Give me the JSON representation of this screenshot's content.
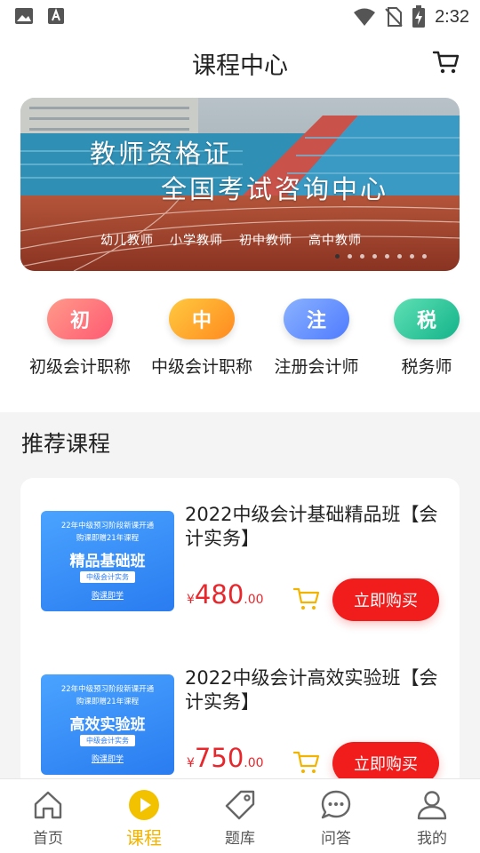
{
  "status_bar": {
    "time": "2:32",
    "icons": [
      "image-icon",
      "font-icon",
      "wifi-icon",
      "no-sim-icon",
      "battery-charging-icon"
    ]
  },
  "header": {
    "title": "课程中心",
    "cart_icon": "cart-icon"
  },
  "banner": {
    "headline": "教师资格证",
    "subheadline": "全国考试咨询中心",
    "tags": [
      "幼儿教师",
      "小学教师",
      "初中教师",
      "高中教师"
    ],
    "slide_count": 8,
    "active_slide": 1
  },
  "categories": [
    {
      "badge": "初",
      "label": "初级会计职称",
      "color": "#ff6f7a"
    },
    {
      "badge": "中",
      "label": "中级会计职称",
      "color": "#ffa41f"
    },
    {
      "badge": "注",
      "label": "注册会计师",
      "color": "#5b8dff"
    },
    {
      "badge": "税",
      "label": "税务师",
      "color": "#1fbf8f"
    }
  ],
  "recommended": {
    "title": "推荐课程",
    "courses": [
      {
        "name": "2022中级会计基础精品班【会计实务】",
        "currency": "¥",
        "price_int": "480",
        "price_dec": ".00",
        "buy_label": "立即购买",
        "thumb": {
          "line1": "22年中级预习阶段新课开通",
          "line2": "购课即赠21年课程",
          "main": "精品基础班",
          "badge": "中级会计实务",
          "link": "购课即学"
        }
      },
      {
        "name": "2022中级会计高效实验班【会计实务】",
        "currency": "¥",
        "price_int": "750",
        "price_dec": ".00",
        "buy_label": "立即购买",
        "thumb": {
          "line1": "22年中级预习阶段新课开通",
          "line2": "购课即赠21年课程",
          "main": "高效实验班",
          "badge": "中级会计实务",
          "link": "购课即学"
        }
      }
    ]
  },
  "tabbar": {
    "items": [
      {
        "label": "首页",
        "icon": "home-icon"
      },
      {
        "label": "课程",
        "icon": "play-icon",
        "active": true
      },
      {
        "label": "题库",
        "icon": "tag-icon"
      },
      {
        "label": "问答",
        "icon": "chat-icon"
      },
      {
        "label": "我的",
        "icon": "user-icon"
      }
    ],
    "accent": "#f2b400"
  }
}
